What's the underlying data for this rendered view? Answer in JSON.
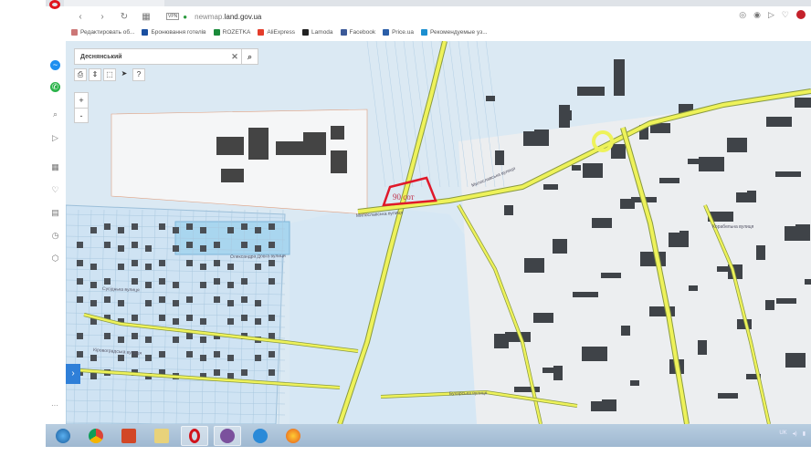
{
  "browser": {
    "url_domain": "land.gov.ua",
    "url_prefix": "newmap.",
    "vpn_label": "VPN",
    "bookmarks": [
      {
        "label": "Редактировать об...",
        "color": "#c77"
      },
      {
        "label": "Бронювання готелів",
        "color": "#1a4fa0"
      },
      {
        "label": "ROZETKA",
        "color": "#1a8a3a"
      },
      {
        "label": "AliExpress",
        "color": "#e43d2b"
      },
      {
        "label": "Lamoda",
        "color": "#222"
      },
      {
        "label": "Facebook",
        "color": "#3b5998"
      },
      {
        "label": "Price.ua",
        "color": "#2a5ea8"
      },
      {
        "label": "Рекомендуемые уз...",
        "color": "#1b8fd0"
      }
    ]
  },
  "map": {
    "search_value": "Деснянський",
    "zoom_in": "+",
    "zoom_out": "-",
    "parcel_label": "90 сот",
    "parcel_color": "#e0192a",
    "street_labels": [
      "Милославська вулиця",
      "Милославська вулиця",
      "Олександра Довга вулиця",
      "Сусіднька вулиця",
      "Кіровоградська вулиця",
      "Бухарська вулиця",
      "Корабельна вулиця"
    ],
    "tools": [
      "print-icon",
      "measure-icon",
      "select-area-icon",
      "pointer-icon",
      "help-icon"
    ]
  },
  "taskbar": {
    "apps": [
      "start",
      "chrome",
      "powerpoint",
      "explorer",
      "opera",
      "viber",
      "internet-explorer",
      "firefox"
    ],
    "active": "opera",
    "tray_lang": "UK"
  }
}
